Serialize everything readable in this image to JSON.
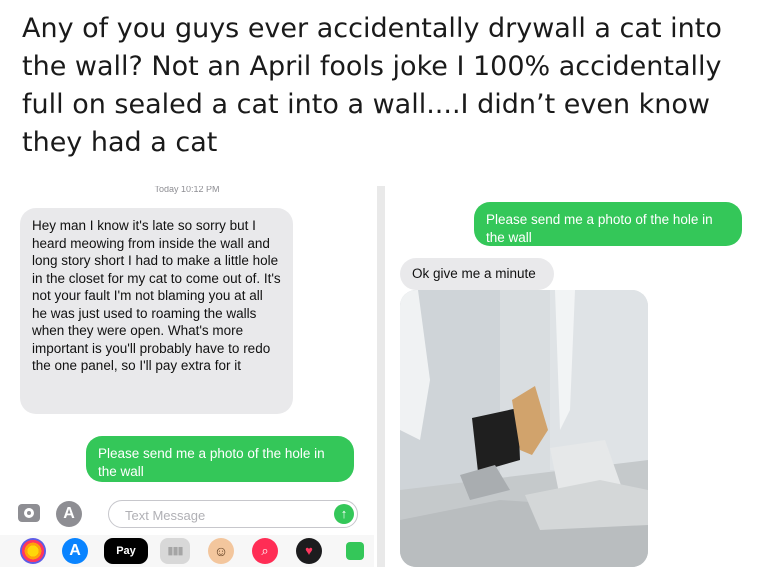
{
  "caption": "Any of you guys ever accidentally drywall a cat into the wall? Not an April fools joke I 100% accidentally full on sealed a cat into a wall....I didn’t even know they had a cat",
  "left_screen": {
    "timestamp": "Today 10:12 PM",
    "messages": [
      {
        "direction": "incoming",
        "text": "Hey man I know it's late so sorry but I heard meowing from inside the wall and long story short I had to make a little hole in the closet for my cat to come out of. It's not your fault I'm not blaming you at all he was just used to roaming the walls when they were open. What's more important is you'll probably have to redo the one panel, so I'll pay extra for it"
      },
      {
        "direction": "outgoing",
        "text": "Please send me a photo of the hole in the wall"
      }
    ],
    "input": {
      "placeholder": "Text Message",
      "value": ""
    },
    "icons": {
      "camera": "camera-icon",
      "apps": "app-store-icon",
      "send": "send-arrow-icon"
    },
    "drawer": {
      "icons": [
        "photos-icon",
        "app-store-icon",
        "apple-pay-icon",
        "music-icon",
        "memoji-icon",
        "image-search-icon",
        "digital-touch-icon",
        "more-icon"
      ],
      "apple_pay_label": "Pay"
    }
  },
  "right_screen": {
    "messages": [
      {
        "direction": "outgoing",
        "text": "Please send me a photo of the hole in the wall"
      },
      {
        "direction": "incoming",
        "text": "Ok give me a minute"
      }
    ],
    "photo": {
      "icon": "photo-of-drywall-hole"
    }
  },
  "colors": {
    "imessage_blue_green": "#34c759",
    "incoming_bubble": "#e9e9eb"
  }
}
